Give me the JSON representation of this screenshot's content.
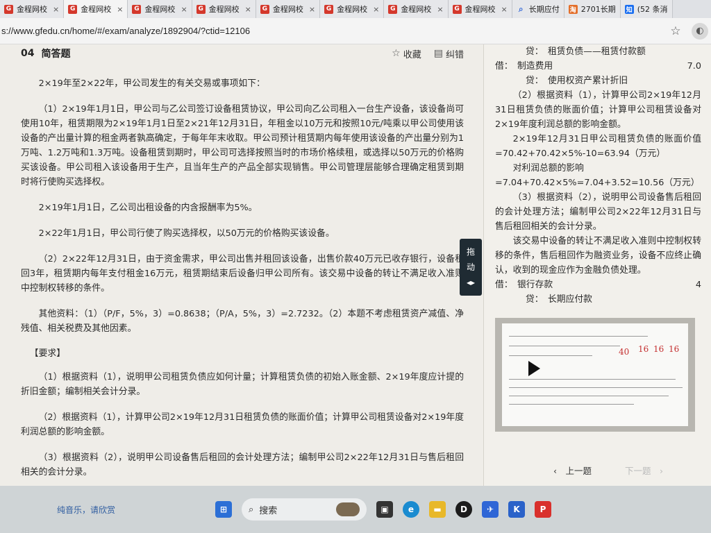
{
  "tabs": [
    {
      "label": "金程网校",
      "icon": "gfedu-icon",
      "active": false
    },
    {
      "label": "金程网校",
      "icon": "gfedu-icon",
      "active": true
    },
    {
      "label": "金程网校",
      "icon": "gfedu-icon",
      "active": false
    },
    {
      "label": "金程网校",
      "icon": "gfedu-icon",
      "active": false
    },
    {
      "label": "金程网校",
      "icon": "gfedu-icon",
      "active": false
    },
    {
      "label": "金程网校",
      "icon": "gfedu-icon",
      "active": false
    },
    {
      "label": "金程网校",
      "icon": "gfedu-icon",
      "active": false
    },
    {
      "label": "金程网校",
      "icon": "gfedu-icon",
      "active": false
    },
    {
      "label": "长期应付",
      "icon": "search-icon",
      "active": false
    },
    {
      "label": "2701长期",
      "icon": "taobao-icon",
      "active": false
    },
    {
      "label": "(52 条消",
      "icon": "zhihu-icon",
      "active": false
    }
  ],
  "address": {
    "url": "s://www.gfedu.cn/home/#/exam/analyze/1892904/?ctid=12106"
  },
  "question": {
    "number": "04",
    "type": "简答题",
    "favorite_label": "收藏",
    "report_label": "纠错",
    "paragraphs": [
      "2×19年至2×22年，甲公司发生的有关交易或事项如下：",
      "（1）2×19年1月1日，甲公司与乙公司签订设备租赁协议，甲公司向乙公司租入一台生产设备，该设备尚可使用10年，租赁期限为2×19年1月1日至2×21年12月31日，年租金以10万元和按照10元/吨乘以甲公司使用该设备的产出量计算的租金两者孰高确定，于每年年末收取。甲公司预计租赁期内每年使用该设备的产出量分别为1万吨、1.2万吨和1.3万吨。设备租赁到期时，甲公司可选择按照当时的市场价格续租，或选择以50万元的价格购买该设备。甲公司租入该设备用于生产，且当年生产的产品全部实现销售。甲公司管理层能够合理确定租赁到期时将行使购买选择权。",
      "2×19年1月1日，乙公司出租设备的内含报酬率为5%。",
      "2×22年1月1日，甲公司行使了购买选择权，以50万元的价格购买该设备。",
      "（2）2×22年12月31日，由于资金需求，甲公司出售并租回该设备，出售价款40万元已收存银行，设备租回3年，租赁期内每年支付租金16万元，租赁期结束后设备归甲公司所有。该交易中设备的转让不满足收入准则中控制权转移的条件。",
      "其他资料：（1）（P/F，5%，3）=0.8638；（P/A，5%，3）=2.7232。（2）本题不考虑租赁资产减值、净残值、相关税费及其他因素。"
    ],
    "requirement_title": "【要求】",
    "requirements": [
      "（1）根据资料（1），说明甲公司租赁负债应如何计量；计算租赁负债的初始入账金额、2×19年度应计提的折旧金额；编制相关会计分录。",
      "（2）根据资料（1），计算甲公司2×19年12月31日租赁负债的账面价值；计算甲公司租赁设备对2×19年度利润总额的影响金额。",
      "（3）根据资料（2），说明甲公司设备售后租回的会计处理方法；编制甲公司2×22年12月31日与售后租回相关的会计分录。"
    ]
  },
  "drag_handle": {
    "label_1": "拖",
    "label_2": "动"
  },
  "analysis": {
    "line1": "贷：　租赁负债——租赁付款额",
    "line2_label": "借：　制造费用",
    "line2_amount": "7.0",
    "line3": "贷：　使用权资产累计折旧",
    "p1": "（2）根据资料（1），计算甲公司2×19年12月31日租赁负债的账面价值；计算甲公司租赁设备对2×19年度利润总额的影响金额。",
    "p2": "2×19年12月31日甲公司租赁负债的账面价值=70.42+70.42×5%-10=63.94（万元）",
    "p3": "对利润总额的影响",
    "p4": "=7.04+70.42×5%=7.04+3.52=10.56（万元）",
    "p5": "（3）根据资料（2），说明甲公司设备售后租回的会计处理方法；编制甲公司2×22年12月31日与售后租回相关的会计分录。",
    "p6": "该交易中设备的转让不满足收入准则中控制权转移的条件，售后租回作为融资业务，设备不应终止确认，收到的现金应作为金融负债处理。",
    "line4_label": "借：　银行存款",
    "line4_amount": "4",
    "line5": "贷：　长期应付款"
  },
  "video": {
    "scribble_1": "40",
    "scribble_2": "16",
    "scribble_3": "16",
    "scribble_4": "16"
  },
  "pager": {
    "prev_label": "上一题",
    "next_label": "下一题"
  },
  "taskbar": {
    "media_text": "纯音乐，请欣赏",
    "search_placeholder": "搜索"
  }
}
